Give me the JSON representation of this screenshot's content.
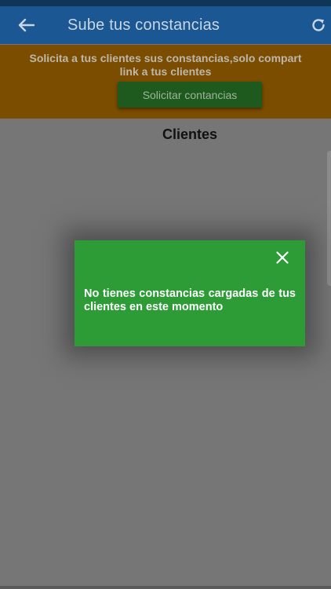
{
  "app_bar": {
    "title": "Sube tus constancias",
    "back_icon": "arrow-left-icon",
    "refresh_icon": "refresh-icon"
  },
  "banner": {
    "message": "Solicita a tus clientes sus constancias,solo compart\nlink a tus clientes",
    "button_label": "Solicitar contancias"
  },
  "section": {
    "title": "Clientes"
  },
  "dialog": {
    "message": "No tienes constancias cargadas de tus clientes en este momento",
    "close_icon": "close-icon"
  },
  "colors": {
    "app_bar": "#1a5793",
    "banner": "#7b4d00",
    "button": "#1e5a1e",
    "dialog": "#2d9c37",
    "background": "#767676"
  }
}
